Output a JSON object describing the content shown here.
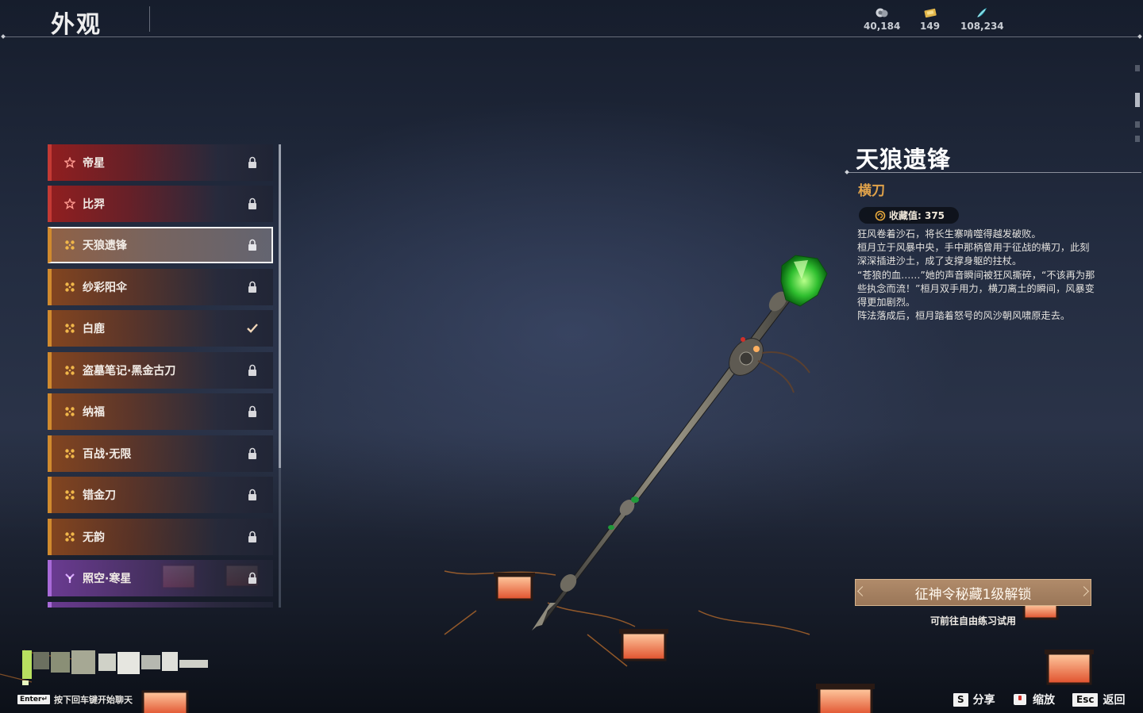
{
  "header": {
    "title": "外观"
  },
  "currencies": [
    {
      "icon": "silver-coin-icon",
      "value": "40,184"
    },
    {
      "icon": "gold-ticket-icon",
      "value": "149"
    },
    {
      "icon": "jade-feather-icon",
      "value": "108,234"
    }
  ],
  "list": {
    "items": [
      {
        "label": "帝星",
        "rarity": "red",
        "state": "locked"
      },
      {
        "label": "比羿",
        "rarity": "red",
        "state": "locked"
      },
      {
        "label": "天狼遗锋",
        "rarity": "gold",
        "state": "locked",
        "selected": true
      },
      {
        "label": "纱彩阳伞",
        "rarity": "gold",
        "state": "locked"
      },
      {
        "label": "白鹿",
        "rarity": "gold",
        "state": "equipped"
      },
      {
        "label": "盗墓笔记·黑金古刀",
        "rarity": "gold",
        "state": "locked"
      },
      {
        "label": "纳福",
        "rarity": "gold",
        "state": "locked"
      },
      {
        "label": "百战·无限",
        "rarity": "gold",
        "state": "locked"
      },
      {
        "label": "错金刀",
        "rarity": "gold",
        "state": "locked"
      },
      {
        "label": "无韵",
        "rarity": "gold",
        "state": "locked"
      },
      {
        "label": "照空·寒星",
        "rarity": "purple",
        "state": "locked"
      }
    ]
  },
  "detail": {
    "name": "天狼遗锋",
    "type": "横刀",
    "collection_label": "收藏值: 375",
    "description": [
      "狂风卷着沙石，将长生寨啃噬得越发破败。",
      "桓月立于风暴中央，手中那柄曾用于征战的横刀，此刻深深插进沙土，成了支撑身躯的拄杖。",
      "“苍狼的血……”她的声音瞬间被狂风撕碎，“不该再为那些执念而流！”桓月双手用力，横刀离土的瞬间，风暴变得更加剧烈。",
      "阵法落成后，桓月踏着怒号的风沙朝风啸原走去。"
    ],
    "unlock_button": "征神令秘藏1级解锁",
    "unlock_sub": "可前往自由练习试用"
  },
  "footer": {
    "chat_key": "Enter↵",
    "chat_hint": "按下回车键开始聊天",
    "actions": [
      {
        "key": "S",
        "label": "分享"
      },
      {
        "key": "",
        "label": "缩放"
      },
      {
        "key": "Esc",
        "label": "返回"
      }
    ]
  },
  "colors": {
    "red": "#c33a34",
    "gold": "#d08a2e",
    "purple": "#a86ad8",
    "accent_text": "#e0a24a"
  }
}
